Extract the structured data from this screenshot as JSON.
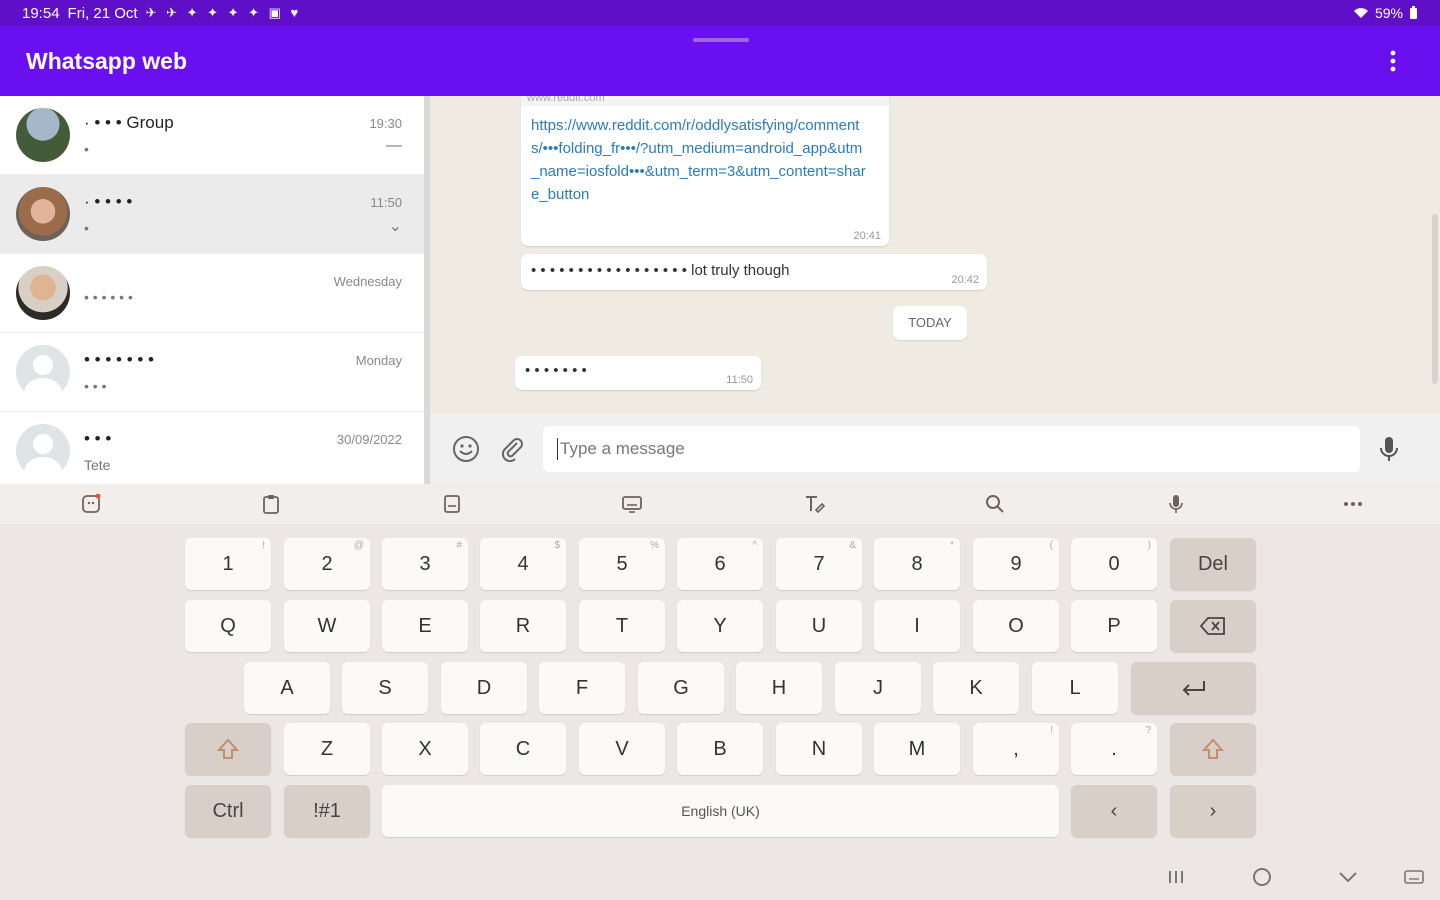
{
  "status_bar": {
    "time": "19:54",
    "date": "Fri, 21 Oct",
    "notification_icons": "✈ ✈ ✦ ✦ ✦ ✦ ▣ ♥",
    "battery": "59%"
  },
  "app_bar": {
    "title": "Whatsapp web",
    "menu_icon": "more-vert-icon"
  },
  "chats": [
    {
      "name": "· • • • Group",
      "preview": "•",
      "time": "19:30",
      "avatar": "photo1",
      "extra": "—"
    },
    {
      "name": "· • • • •",
      "preview": "•",
      "time": "11:50",
      "avatar": "photo2",
      "extra": "⌄"
    },
    {
      "name": "",
      "preview": "• • • • • •",
      "time": "Wednesday",
      "avatar": "photo3",
      "extra": ""
    },
    {
      "name": "• • • • • • •",
      "preview": "• • •",
      "time": "Monday",
      "avatar": "placeholder",
      "extra": ""
    },
    {
      "name": "• • •",
      "preview": "Tete",
      "time": "30/09/2022",
      "avatar": "placeholder",
      "extra": ""
    }
  ],
  "messages": {
    "link_bubble": {
      "domain": "www.reddit.com",
      "url": "https://www.reddit.com/r/oddlysatisfying/comments/•••folding_fr•••/?utm_medium=android_app&utm_name=iosfold•••&utm_term=3&utm_content=share_button",
      "time": "20:41"
    },
    "text_bubble": {
      "text": "• • • • • • • • • • • • • • • • • lot truly though",
      "time": "20:42"
    },
    "day_chip": "TODAY",
    "small_bubble": {
      "text": "• • • • • • •",
      "time": "11:50"
    }
  },
  "compose": {
    "placeholder": "Type a message",
    "emoji_icon": "emoji-icon",
    "attach_icon": "paperclip-icon",
    "mic_icon": "microphone-icon"
  },
  "keyboard_toolbar": [
    {
      "icon": "emoji-sticker-icon"
    },
    {
      "icon": "clipboard-icon"
    },
    {
      "icon": "keyboard-icon"
    },
    {
      "icon": "keyboard-settings-icon"
    },
    {
      "icon": "text-edit-icon"
    },
    {
      "icon": "search-icon"
    },
    {
      "icon": "voice-input-icon"
    },
    {
      "icon": "more-horiz-icon"
    }
  ],
  "keyboard": {
    "row1": [
      {
        "label": "1",
        "hint": "!"
      },
      {
        "label": "2",
        "hint": "@"
      },
      {
        "label": "3",
        "hint": "#"
      },
      {
        "label": "4",
        "hint": "$"
      },
      {
        "label": "5",
        "hint": "%"
      },
      {
        "label": "6",
        "hint": "^"
      },
      {
        "label": "7",
        "hint": "&"
      },
      {
        "label": "8",
        "hint": "*"
      },
      {
        "label": "9",
        "hint": "("
      },
      {
        "label": "0",
        "hint": ")"
      },
      {
        "label": "Del",
        "hint": ""
      }
    ],
    "row2": [
      "Q",
      "W",
      "E",
      "R",
      "T",
      "Y",
      "U",
      "I",
      "O",
      "P"
    ],
    "row3": [
      "A",
      "S",
      "D",
      "F",
      "G",
      "H",
      "J",
      "K",
      "L"
    ],
    "row4": [
      "Z",
      "X",
      "C",
      "V",
      "B",
      "N",
      "M"
    ],
    "comma": {
      "label": ",",
      "hint": "!"
    },
    "period": {
      "label": ".",
      "hint": "?"
    },
    "ctrl": "Ctrl",
    "symbols": "!#1",
    "space": "English (UK)",
    "left_arrow": "‹",
    "right_arrow": "›"
  },
  "navbar": {
    "recent": "recent-apps-icon",
    "home": "home-icon",
    "back": "back-icon",
    "keyboard": "keyboard-hide-icon"
  },
  "colors": {
    "app_bar": "#6a0ff0",
    "status_bar": "#5f0fc7",
    "link": "#2b7bbf"
  }
}
